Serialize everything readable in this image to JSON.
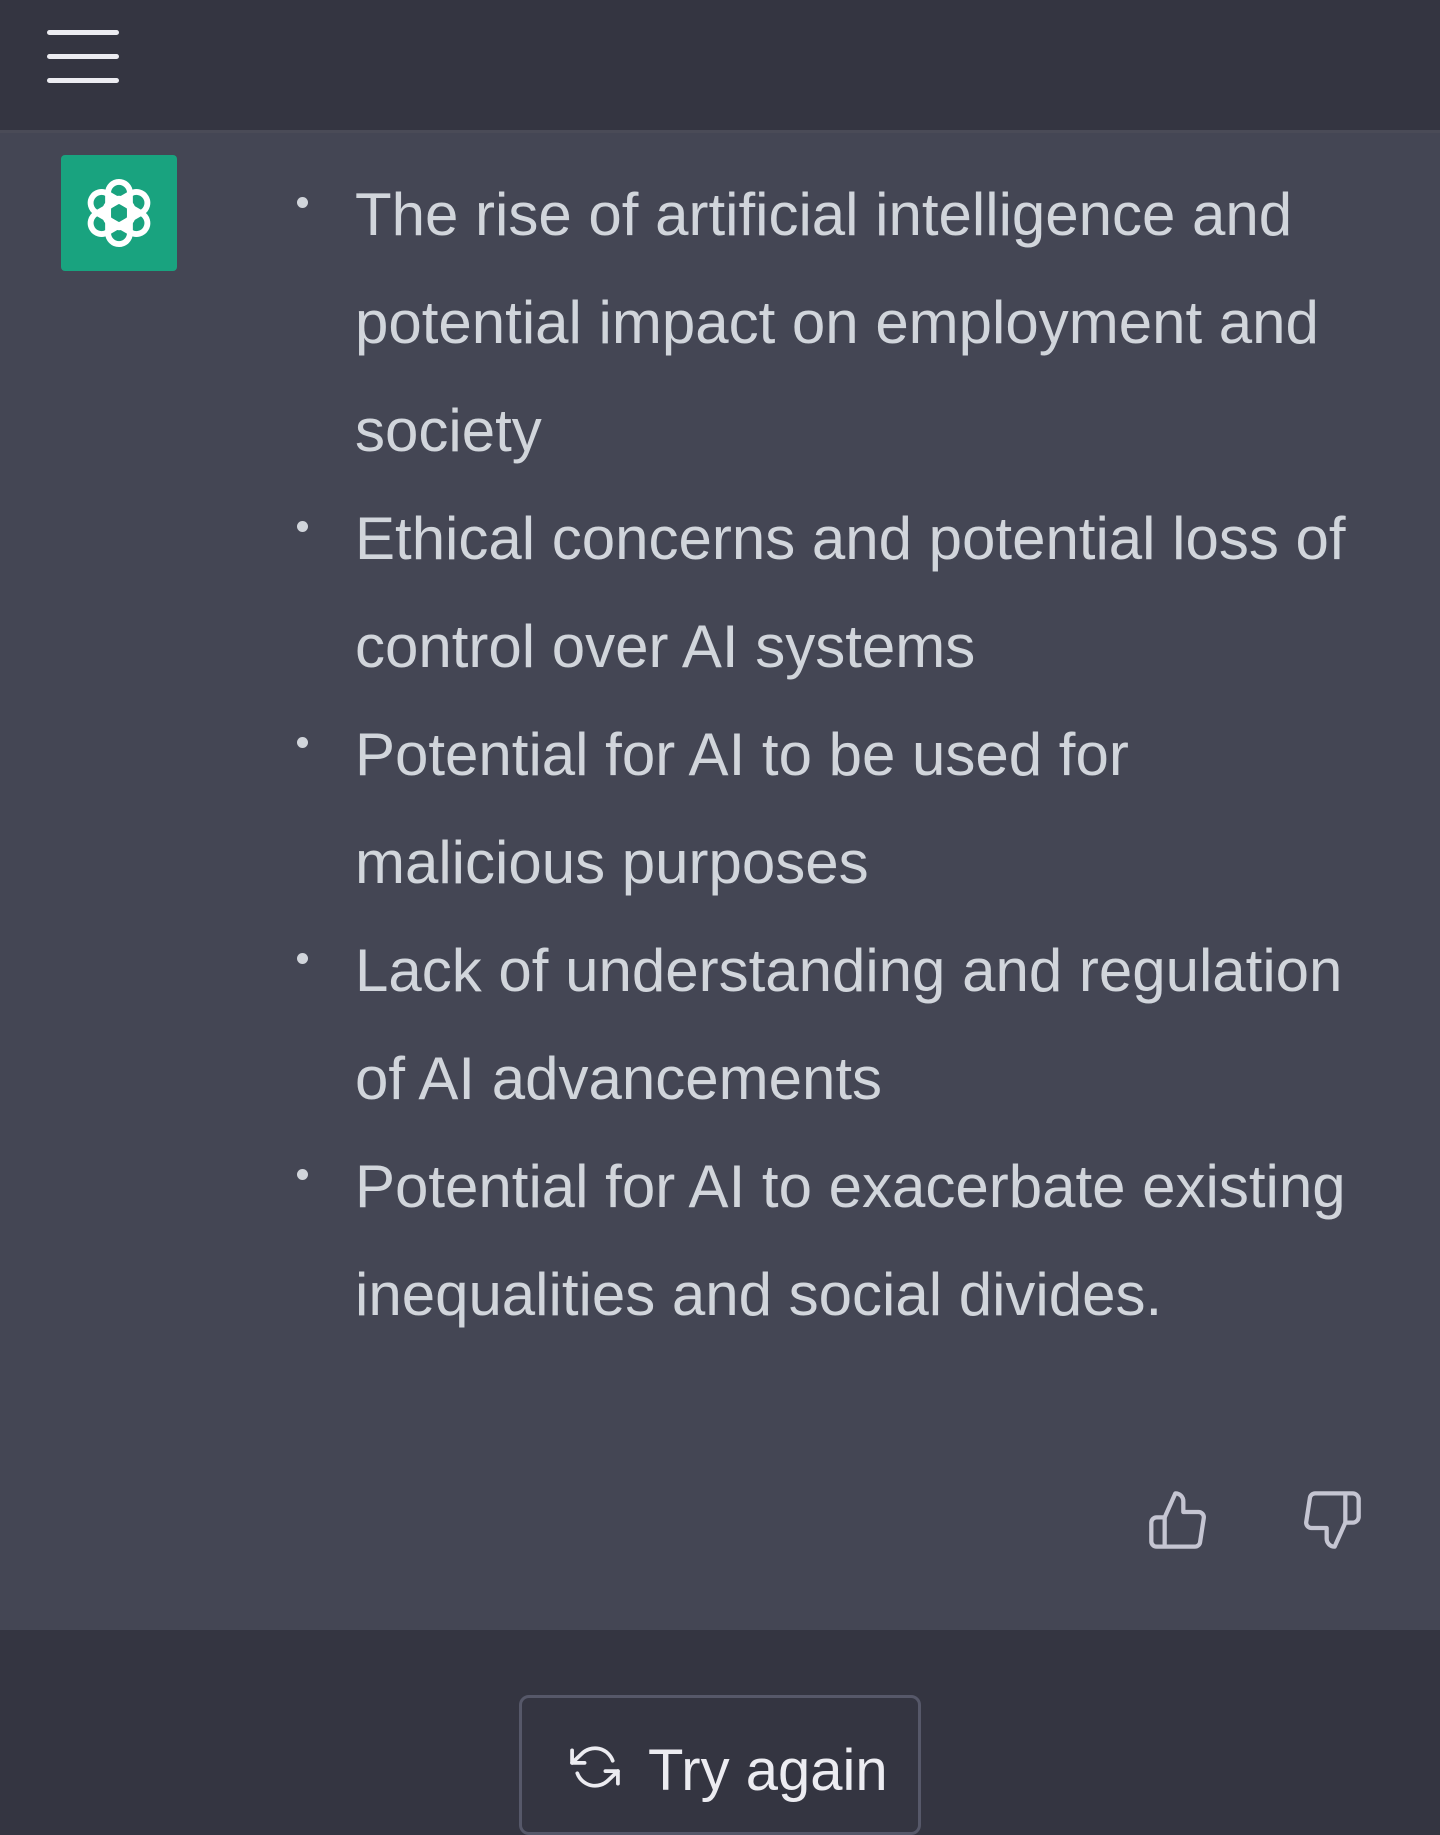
{
  "header": {
    "menu_icon": "hamburger-menu-icon"
  },
  "message": {
    "avatar_icon": "openai-logo-icon",
    "avatar_color": "#19a37f",
    "bullets": [
      "The rise of artificial intelligence and potential impact on employment and society",
      "Ethical concerns and potential loss of control over AI systems",
      "Potential for AI to be used for malicious purposes",
      "Lack of understanding and regulation of AI advancements",
      "Potential for AI to exacerbate existing inequalities and social divides."
    ],
    "feedback": {
      "up_icon": "thumbs-up-icon",
      "down_icon": "thumbs-down-icon"
    }
  },
  "footer": {
    "try_again_label": "Try again",
    "try_again_icon": "refresh-icon"
  },
  "colors": {
    "page_background": "#343541",
    "message_background": "#444654",
    "text": "#d1d5db"
  }
}
